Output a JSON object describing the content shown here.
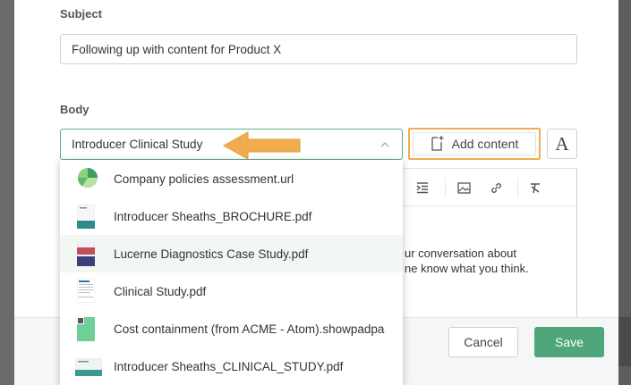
{
  "subject": {
    "label": "Subject",
    "value": "Following up with content for Product X"
  },
  "body": {
    "label": "Body",
    "selected": "Introducer Clinical Study",
    "add_content_label": "Add content",
    "font_button": "A",
    "text_line1": "ur conversation about",
    "text_line2": "ne know what you think."
  },
  "dropdown": {
    "items": [
      {
        "label": "Company policies assessment.url",
        "icon": "url-pie-icon"
      },
      {
        "label": "Introducer Sheaths_BROCHURE.pdf",
        "icon": "pdf-thumbnail"
      },
      {
        "label": "Lucerne Diagnostics Case Study.pdf",
        "icon": "pdf-thumbnail"
      },
      {
        "label": "Clinical Study.pdf",
        "icon": "pdf-thumbnail"
      },
      {
        "label": "Cost containment (from ACME - Atom).showpadpa",
        "icon": "showpad-thumbnail"
      },
      {
        "label": "Introducer Sheaths_CLINICAL_STUDY.pdf",
        "icon": "pdf-thumbnail"
      }
    ],
    "highlighted_index": 2
  },
  "footer": {
    "cancel_label": "Cancel",
    "save_label": "Save"
  },
  "colors": {
    "accent_green": "#4fa67b",
    "highlight_orange": "#f0ad4e",
    "select_border": "#59b28a"
  }
}
